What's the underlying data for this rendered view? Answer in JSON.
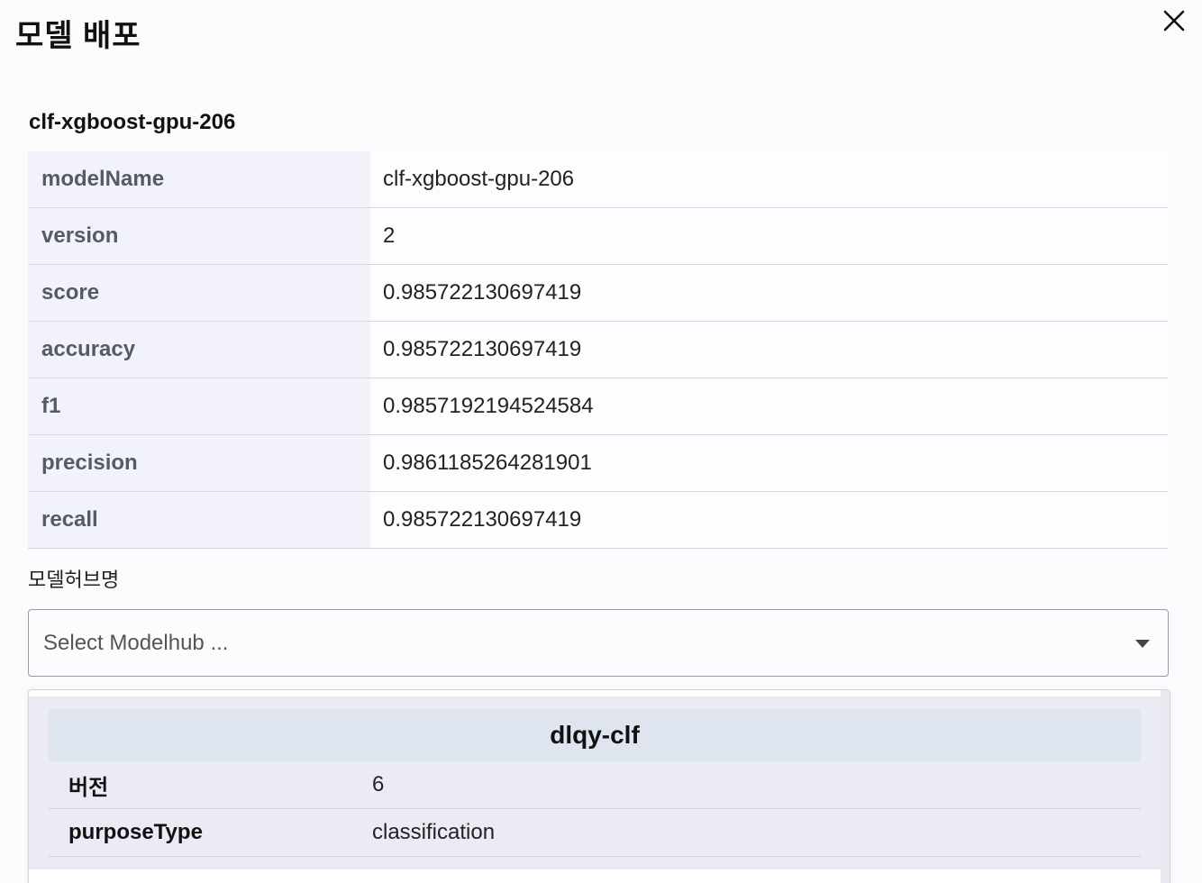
{
  "dialog": {
    "title": "모델 배포",
    "close_icon": "close-icon"
  },
  "model": {
    "name": "clf-xgboost-gpu-206",
    "properties": [
      {
        "key": "modelName",
        "value": "clf-xgboost-gpu-206"
      },
      {
        "key": "version",
        "value": "2"
      },
      {
        "key": "score",
        "value": "0.985722130697419"
      },
      {
        "key": "accuracy",
        "value": "0.985722130697419"
      },
      {
        "key": "f1",
        "value": "0.9857192194524584"
      },
      {
        "key": "precision",
        "value": "0.9861185264281901"
      },
      {
        "key": "recall",
        "value": "0.985722130697419"
      }
    ]
  },
  "modelhub": {
    "label": "모델허브명",
    "placeholder": "Select Modelhub ...",
    "caret_icon": "caret-down-icon",
    "options": [
      {
        "name": "dlqy-clf",
        "rows": [
          {
            "key": "버전",
            "value": "6"
          },
          {
            "key": "purposeType",
            "value": "classification"
          }
        ]
      }
    ]
  }
}
